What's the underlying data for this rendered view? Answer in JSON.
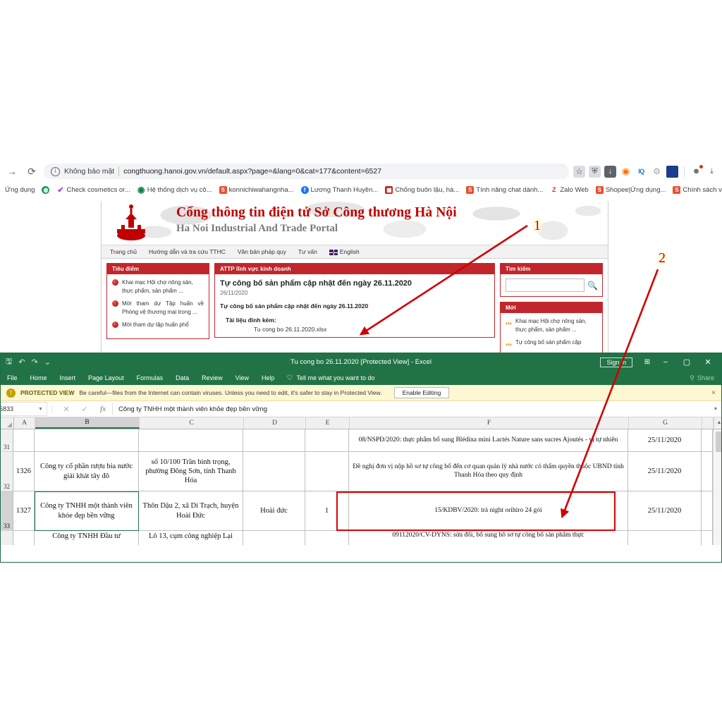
{
  "browser": {
    "back_icon": "arrow-back-icon",
    "forward_icon": "arrow-forward-icon",
    "reload_icon": "reload-icon",
    "security_label": "Không bảo mật",
    "url": "congthuong.hanoi.gov.vn/default.aspx?page=&lang=0&cat=177&content=6527",
    "toolbar_icons": [
      "star-icon",
      "shield-icon",
      "download-icon",
      "extension-orange-icon",
      "iq-icon",
      "gear-icon",
      "blue-square-icon",
      "profile-icon",
      "downloads-icon"
    ],
    "bookmarks_label": "Ứng dụng",
    "bookmarks": [
      {
        "label": "Check cosmetics or...",
        "favicon": "check-icon"
      },
      {
        "label": "Hệ thống dịch vụ cô...",
        "favicon": "green-circle-icon"
      },
      {
        "label": "konnichiwahangnha...",
        "favicon": "shopee-icon"
      },
      {
        "label": "Lương Thanh Huyền...",
        "favicon": "facebook-icon"
      },
      {
        "label": "Chống buôn lậu, hà...",
        "favicon": "red-icon"
      },
      {
        "label": "Tính năng chat dành...",
        "favicon": "shopee-icon"
      },
      {
        "label": "Zalo Web",
        "favicon": "zalo-icon"
      },
      {
        "label": "Shopee|Ứng dụng...",
        "favicon": "shopee-icon"
      },
      {
        "label": "Chính sách về vi pha...",
        "favicon": "shopee-icon"
      }
    ],
    "bookmarks_overflow": "»"
  },
  "site": {
    "title": "Cổng thông tin điện tử Sở Công thương Hà Nội",
    "subtitle": "Ha Noi Industrial And Trade Portal",
    "nav": [
      "Trang chủ",
      "Hướng dẫn và tra cứu TTHC",
      "Văn bản pháp quy",
      "Tư vấn",
      "English"
    ],
    "left_panel": {
      "heading": "Tiêu điểm",
      "items": [
        "Khai mạc Hội chợ nông sản, thực phẩm, sản phẩm ...",
        "Mời tham dự Tập huấn về Phòng vệ thương mại trong ...",
        "Mời tham dự tập huấn phổ"
      ]
    },
    "main_panel": {
      "heading": "ATTP lĩnh vực kinh doanh",
      "article_title": "Tự công bố sản phẩm cập nhật đến ngày 26.11.2020",
      "article_date": "26/11/2020",
      "article_lead": "Tự công bố sản phẩm cập nhật đến ngày 26.11.2020",
      "attachment_label": "Tài liệu đính kèm:",
      "attachment_file": "Tu cong bo 26.11.2020.xlsx"
    },
    "search_panel": {
      "heading": "Tìm kiếm",
      "input_value": "",
      "input_placeholder": "",
      "icon": "search-icon"
    },
    "new_panel": {
      "heading": "Mới",
      "items": [
        "Khai mạc Hội chợ nông sản, thực phẩm, sản phẩm ...",
        "Tự công bố sản phẩm cập"
      ]
    }
  },
  "annotations": [
    {
      "label": "1"
    },
    {
      "label": "2"
    }
  ],
  "excel": {
    "title": "Tu cong bo 26.11.2020  [Protected View]  -  Excel",
    "quick_access": [
      "save-icon",
      "undo-icon",
      "redo-icon",
      "customize-icon"
    ],
    "signin_label": "Sign in",
    "ribbon_display_icon": "ribbon-display-icon",
    "minimize_icon": "minimize-icon",
    "maximize_icon": "maximize-icon",
    "close_icon": "close-icon",
    "tabs": [
      "File",
      "Home",
      "Insert",
      "Page Layout",
      "Formulas",
      "Data",
      "Review",
      "View",
      "Help"
    ],
    "tell_me": "Tell me what you want to do",
    "share_label": "Share",
    "protected_view": {
      "badge": "PROTECTED VIEW",
      "message": "Be careful—files from the Internet can contain viruses. Unless you need to edit, it's safer to stay in Protected View.",
      "button": "Enable Editing",
      "close": "×"
    },
    "formula_bar": {
      "name_box": "5833",
      "cancel_icon": "cancel-icon",
      "confirm_icon": "confirm-icon",
      "fx_icon": "fx-icon",
      "value": "Công ty TNHH một thành viên khỏe đẹp bền vững"
    },
    "grid": {
      "columns": [
        "A",
        "B",
        "C",
        "D",
        "E",
        "F",
        "G",
        ""
      ],
      "selected_column": "B",
      "rows": [
        {
          "number": "31",
          "selected": false,
          "cells": [
            "",
            "",
            "",
            "",
            "",
            "08/NSPĐ/2020: thực phẩm bổ sung Blédina mini Lactés  Nature sans sucres Ajoutés - vị tự nhiên",
            "25/11/2020",
            ""
          ]
        },
        {
          "number": "32",
          "selected": false,
          "cells": [
            "1326",
            "Công ty cổ phần rượu bia nước giải khát tây đô",
            "số 10/100 Trần bình trọng, phường Đông Sơn, tỉnh Thanh Hóa",
            "",
            "",
            "Đề nghị đơn vị nộp hồ sơ tự công bố đến cơ quan quản lý nhà nước có thẩm quyền thuộc UBND tỉnh Thanh Hóa  theo quy định",
            "25/11/2020",
            ""
          ]
        },
        {
          "number": "33",
          "selected": true,
          "cells": [
            "1327",
            "Công ty TNHH một thành viên khỏe đẹp bền vững",
            "Thôn Dậu 2, xã Di Trạch, huyện Hoài Đức",
            "Hoài đức",
            "1",
            "15/KDBV/2020: trà night orihiro 24 gói",
            "25/11/2020",
            ""
          ]
        },
        {
          "number": "",
          "selected": false,
          "cells": [
            "",
            "Công ty TNHH Đầu tư",
            "Lô 13, cụm công nghiệp Lại",
            "",
            "",
            "09112020/CV-DYNS: sửa đổi, bổ sung hồ sơ tự công bố sản phẩm thực",
            "",
            ""
          ]
        }
      ],
      "scrollbar_up_icon": "scroll-up-icon"
    }
  },
  "colors": {
    "excel_green": "#217346",
    "site_red": "#c0262c",
    "annotation_red": "#cc0000",
    "protected_yellow": "#fdf7d3"
  }
}
